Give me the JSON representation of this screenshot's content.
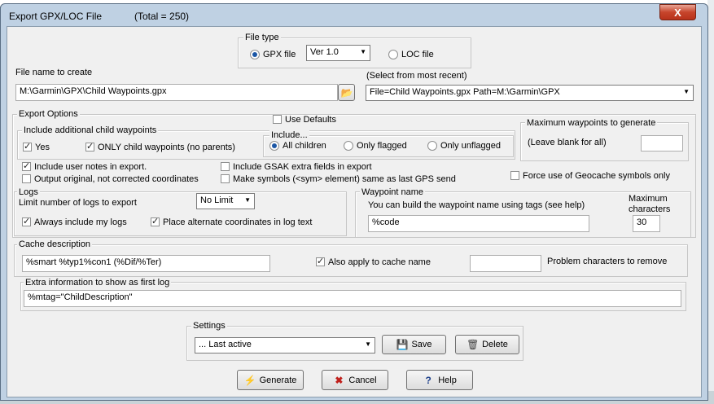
{
  "window": {
    "title": "Export GPX/LOC File",
    "total": "(Total = 250)",
    "close_label": "X"
  },
  "file_type": {
    "group_label": "File type",
    "gpx_label": "GPX file",
    "version": "Ver 1.0",
    "loc_label": "LOC file"
  },
  "file_name": {
    "label": "File name to create",
    "value": "M:\\Garmin\\GPX\\Child Waypoints.gpx",
    "recent_label": "(Select from most recent)",
    "recent_value": "File=Child Waypoints.gpx Path=M:\\Garmin\\GPX"
  },
  "export_options": {
    "group_label": "Export Options",
    "use_defaults": "Use Defaults",
    "child_group_label": "Include additional child waypoints",
    "yes": "Yes",
    "only_child": "ONLY child waypoints (no parents)",
    "include_group_label": "Include...",
    "all_children": "All children",
    "only_flagged": "Only flagged",
    "only_unflagged": "Only unflagged",
    "max_group_label": "Maximum waypoints to generate",
    "max_hint": "(Leave blank for all)",
    "max_value": "",
    "user_notes": "Include user notes in export.",
    "output_original": "Output original, not corrected coordinates",
    "gsak_extra": "Include GSAK extra fields in export",
    "make_symbols": "Make symbols (<sym> element) same as last GPS send",
    "force_geocache": "Force use of Geocache symbols only"
  },
  "logs": {
    "group_label": "Logs",
    "limit_label": "Limit number of logs to export",
    "limit_value": "No Limit",
    "always_include": "Always include my logs",
    "place_alternate": "Place alternate coordinates in log text"
  },
  "waypoint_name": {
    "group_label": "Waypoint name",
    "hint": "You can build the waypoint name using tags (see help)",
    "max_chars_label_1": "Maximum",
    "max_chars_label_2": "characters",
    "value": "%code",
    "max_chars": "30"
  },
  "cache_description": {
    "group_label": "Cache description",
    "value": "%smart %typ1%con1 (%Dif/%Ter)",
    "also_apply": "Also apply to cache name",
    "problem_chars_value": "",
    "problem_chars_label": "Problem characters to remove"
  },
  "extra_info": {
    "group_label": "Extra information to show as first log",
    "value": "%mtag=\"ChildDescription\""
  },
  "settings": {
    "group_label": "Settings",
    "value": "... Last active",
    "save": "Save",
    "delete": "Delete"
  },
  "buttons": {
    "generate": "Generate",
    "cancel": "Cancel",
    "help": "Help"
  },
  "colors": {
    "title_bar": "#bfd1e3",
    "close_button": "#c7452c",
    "dialog_bg": "#f0f0f0"
  }
}
